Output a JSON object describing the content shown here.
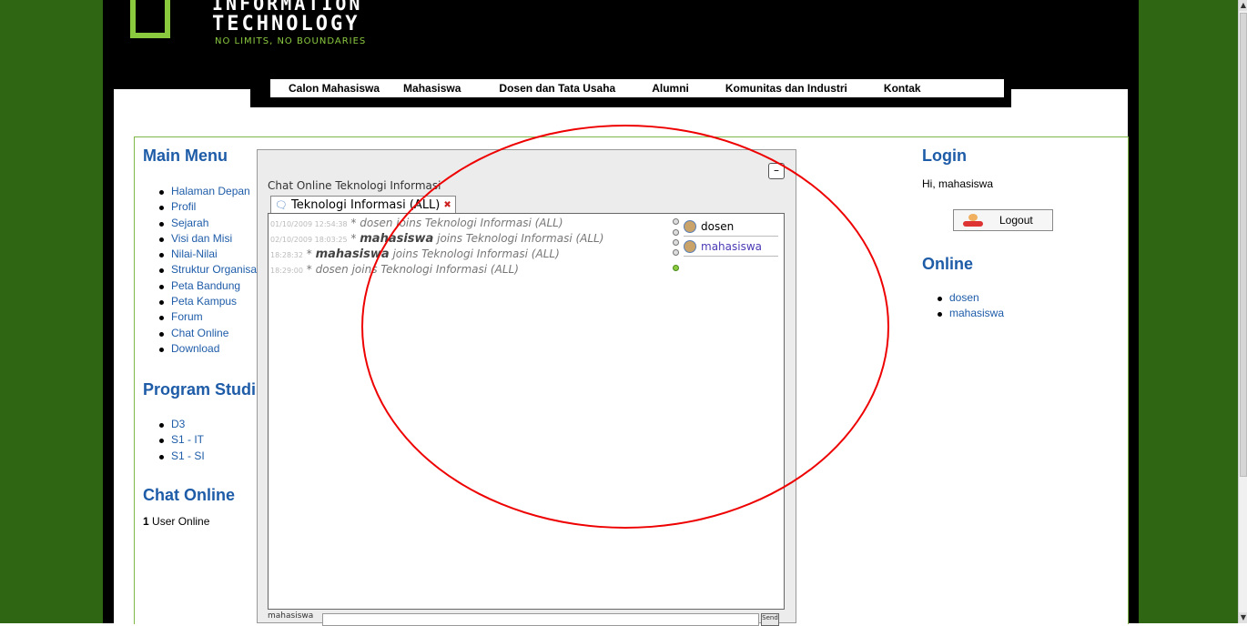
{
  "site": {
    "logo_line1": "INFORMATION",
    "logo_line2": "TECHNOLOGY",
    "tagline": "NO LIMITS, NO BOUNDARIES",
    "brand_green": "#2f6614",
    "accent_lime": "#8bc93f",
    "link_blue": "#1e5ca8"
  },
  "nav": {
    "items": [
      "Calon Mahasiswa",
      "Mahasiswa",
      "Dosen dan Tata Usaha",
      "Alumni",
      "Komunitas dan Industri",
      "Kontak"
    ]
  },
  "left": {
    "main_menu_title": "Main Menu",
    "main_menu": [
      "Halaman Depan",
      "Profil",
      "Sejarah",
      "Visi dan Misi",
      "Nilai-Nilai",
      "Struktur Organisasi",
      "Peta Bandung",
      "Peta Kampus",
      "Forum",
      "Chat Online",
      "Download"
    ],
    "program_title": "Program Studi",
    "program": [
      "D3",
      "S1 - IT",
      "S1 - SI"
    ],
    "chat_title": "Chat Online",
    "users_count": "1",
    "users_label": "User Online"
  },
  "chat": {
    "title": "Chat Online Teknologi Informasi",
    "minimize_label": "–",
    "tab_label": "Teknologi Informasi (ALL)",
    "messages": [
      {
        "ts": "01/10/2009 12:54:38",
        "user": "dosen",
        "text": "* dosen joins Teknologi Informasi (ALL)"
      },
      {
        "ts": "02/10/2009 18:03:25",
        "user": "mahasiswa",
        "text_pre": "* ",
        "text_user": "mahasiswa",
        "text_post": " joins Teknologi Informasi (ALL)"
      },
      {
        "ts": "18:28:32",
        "user": "mahasiswa",
        "text_pre": "* ",
        "text_user": "mahasiswa",
        "text_post": " joins Teknologi Informasi (ALL)"
      },
      {
        "ts": "18:29:00",
        "user": "dosen",
        "text": "* dosen joins Teknologi Informasi (ALL)"
      }
    ],
    "users": [
      "dosen",
      "mahasiswa"
    ],
    "input_user": "mahasiswa",
    "send_label": "Send"
  },
  "right": {
    "login_title": "Login",
    "greeting": "Hi, mahasiswa",
    "logout_label": "Logout",
    "online_title": "Online",
    "online_users": [
      "dosen",
      "mahasiswa"
    ]
  }
}
